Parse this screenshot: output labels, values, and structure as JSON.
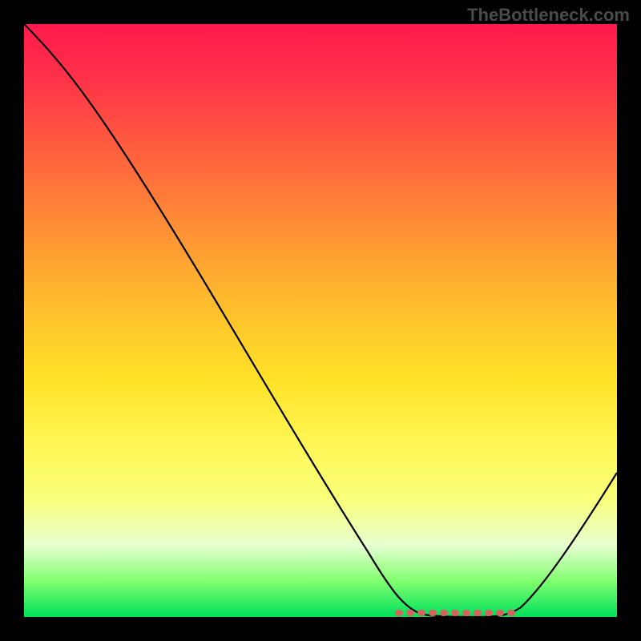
{
  "watermark": "TheBottleneck.com",
  "chart_data": {
    "type": "line",
    "title": "",
    "xlabel": "",
    "ylabel": "",
    "xlim": [
      0,
      100
    ],
    "ylim": [
      0,
      100
    ],
    "series": [
      {
        "name": "curve",
        "x": [
          0,
          5,
          10,
          15,
          20,
          25,
          30,
          35,
          40,
          45,
          50,
          55,
          60,
          62,
          65,
          68,
          72,
          76,
          80,
          82,
          85,
          90,
          95,
          100
        ],
        "y": [
          100,
          97,
          93,
          87,
          80,
          72,
          63,
          54,
          45,
          36,
          27,
          18,
          10,
          6,
          3,
          1,
          0,
          0,
          0,
          1,
          4,
          12,
          22,
          33
        ]
      }
    ],
    "flat_region": {
      "x_start": 63,
      "x_end": 82,
      "y": 0,
      "color": "#d6635d"
    },
    "gradient_stops": [
      {
        "pos": 0,
        "color": "#ff1a4d"
      },
      {
        "pos": 20,
        "color": "#ff5a3f"
      },
      {
        "pos": 46,
        "color": "#ffb92e"
      },
      {
        "pos": 72,
        "color": "#fff85a"
      },
      {
        "pos": 94,
        "color": "#7fff6f"
      },
      {
        "pos": 100,
        "color": "#00e05c"
      }
    ]
  }
}
